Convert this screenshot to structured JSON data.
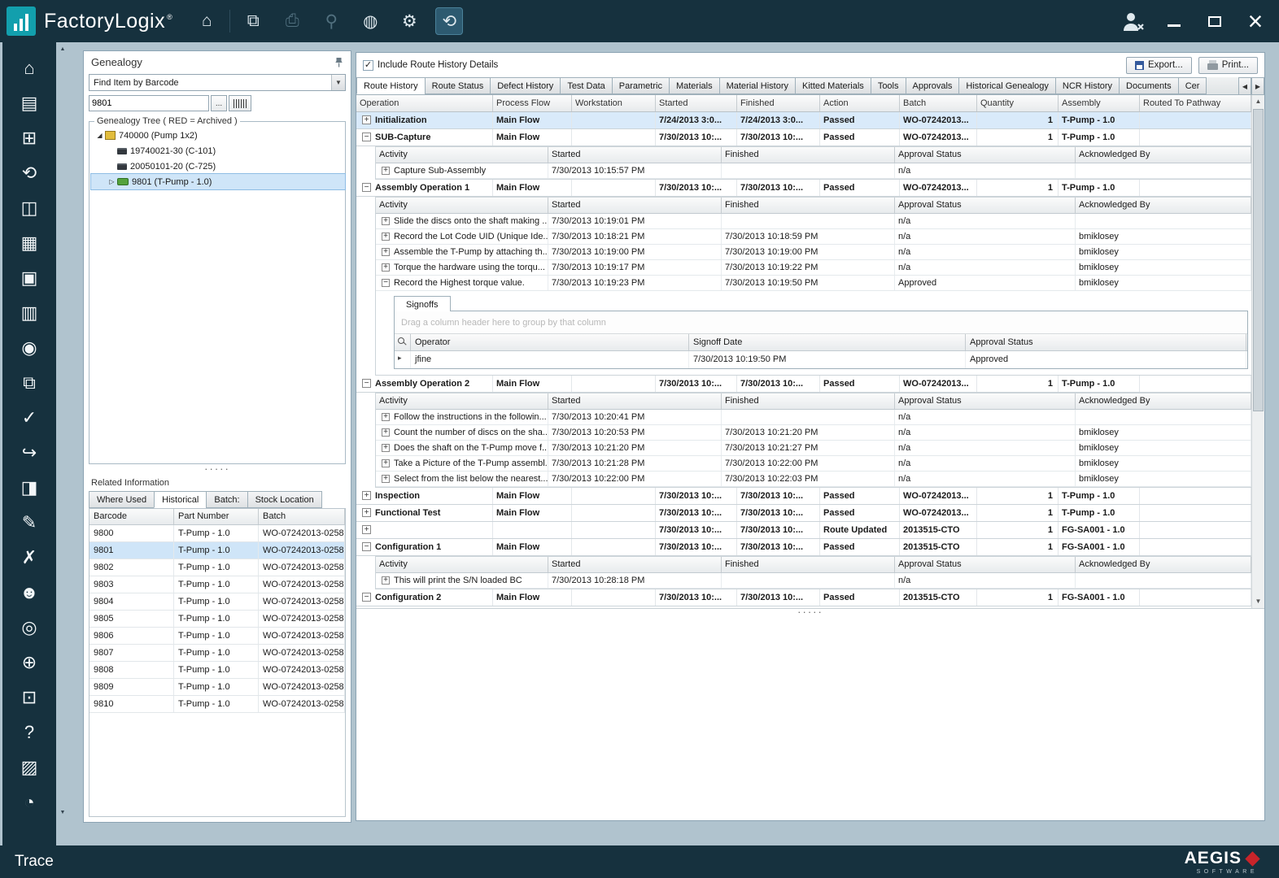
{
  "topbar": {
    "app_name": "FactoryLogix",
    "registered_mark": "®",
    "icons": [
      {
        "name": "home-icon",
        "disabled": false,
        "active": false
      },
      {
        "name": "documents-icon",
        "disabled": false,
        "active": false
      },
      {
        "name": "printer-icon",
        "disabled": true,
        "active": false
      },
      {
        "name": "location-pin-icon",
        "disabled": true,
        "active": false
      },
      {
        "name": "globe-icon",
        "disabled": false,
        "active": false
      },
      {
        "name": "settings-gear-icon",
        "disabled": false,
        "active": false
      },
      {
        "name": "trace-module-icon",
        "disabled": false,
        "active": true
      }
    ]
  },
  "sidebar": {
    "icons": [
      "home-icon",
      "materials-icon",
      "process-flow-icon",
      "trace-icon",
      "monitor-icon",
      "data-query-icon",
      "warehouse-icon",
      "documentation-icon",
      "inspection-icon",
      "documents-copy-icon",
      "tasks-check-icon",
      "export-icon",
      "badge-icon",
      "notes-icon",
      "measure-cancel-icon",
      "operator-time-icon",
      "operator-search-icon",
      "package-add-icon",
      "package-doc-icon",
      "operator-help-icon",
      "clipboard-icon",
      "analytics-icon"
    ]
  },
  "genealogy": {
    "title": "Genealogy",
    "search_combo": "Find Item by Barcode",
    "barcode_input": "9801",
    "ellipsis_button": "...",
    "tree_group_label": "Genealogy Tree ( RED = Archived )",
    "splitter_dots": "·····",
    "tree": [
      {
        "label": "740000 (Pump 1x2)",
        "level": 0,
        "expanded": true,
        "icon": "assembly-icon",
        "selected": false
      },
      {
        "label": "19740021-30 (C-101)",
        "level": 1,
        "expanded": false,
        "icon": "component-icon",
        "selected": false
      },
      {
        "label": "20050101-20 (C-725)",
        "level": 1,
        "expanded": false,
        "icon": "component-icon",
        "selected": false
      },
      {
        "label": "9801 (T-Pump - 1.0)",
        "level": 1,
        "expanded": false,
        "expandable": true,
        "icon": "board-icon",
        "selected": true
      }
    ],
    "related": {
      "title": "Related Information",
      "tabs": [
        "Where Used",
        "Historical",
        "Batch:",
        "Stock Location"
      ],
      "active_tab": "Historical",
      "columns": [
        "Barcode",
        "Part Number",
        "Batch"
      ],
      "selected_row": "9801",
      "rows": [
        [
          "9800",
          "T-Pump - 1.0",
          "WO-07242013-0258"
        ],
        [
          "9801",
          "T-Pump - 1.0",
          "WO-07242013-0258"
        ],
        [
          "9802",
          "T-Pump - 1.0",
          "WO-07242013-0258"
        ],
        [
          "9803",
          "T-Pump - 1.0",
          "WO-07242013-0258"
        ],
        [
          "9804",
          "T-Pump - 1.0",
          "WO-07242013-0258"
        ],
        [
          "9805",
          "T-Pump - 1.0",
          "WO-07242013-0258"
        ],
        [
          "9806",
          "T-Pump - 1.0",
          "WO-07242013-0258"
        ],
        [
          "9807",
          "T-Pump - 1.0",
          "WO-07242013-0258"
        ],
        [
          "9808",
          "T-Pump - 1.0",
          "WO-07242013-0258"
        ],
        [
          "9809",
          "T-Pump - 1.0",
          "WO-07242013-0258"
        ],
        [
          "9810",
          "T-Pump - 1.0",
          "WO-07242013-0258"
        ]
      ]
    }
  },
  "main": {
    "include_details_checkbox": {
      "label": "Include Route History Details",
      "checked": true
    },
    "export_button": "Export...",
    "print_button": "Print...",
    "tabs": [
      "Route History",
      "Route Status",
      "Defect History",
      "Test Data",
      "Parametric",
      "Materials",
      "Material History",
      "Kitted Materials",
      "Tools",
      "Approvals",
      "Historical Genealogy",
      "NCR History",
      "Documents",
      "Cer"
    ],
    "active_tab": "Route History",
    "splitter_dots": "·····",
    "grid": {
      "columns": [
        "Operation",
        "Process Flow",
        "Workstation",
        "Started",
        "Finished",
        "Action",
        "Batch",
        "Quantity",
        "Assembly",
        "Routed To Pathway"
      ],
      "detail_columns": [
        "Activity",
        "Started",
        "Finished",
        "Approval Status",
        "Acknowledged By"
      ],
      "signoffs": {
        "tab": "Signoffs",
        "groupby_hint": "Drag a column header here to group by that column",
        "columns": [
          "Operator",
          "Signoff Date",
          "Approval Status"
        ],
        "rows": [
          [
            "jfine",
            "7/30/2013 10:19:50 PM",
            "Approved"
          ]
        ]
      },
      "rows": [
        {
          "expand": "+",
          "op": "Initialization",
          "flow": "Main Flow",
          "workstation": "",
          "started": "7/24/2013 3:0...",
          "finished": "7/24/2013 3:0...",
          "action": "Passed",
          "batch": "WO-07242013...",
          "qty": "1",
          "assembly": "T-Pump - 1.0",
          "routed": "",
          "selected": true
        },
        {
          "expand": "-",
          "op": "SUB-Capture",
          "flow": "Main Flow",
          "workstation": "",
          "started": "7/30/2013 10:...",
          "finished": "7/30/2013 10:...",
          "action": "Passed",
          "batch": "WO-07242013...",
          "qty": "1",
          "assembly": "T-Pump - 1.0",
          "routed": "",
          "selected": false,
          "details": [
            {
              "expand": "+",
              "activity": "Capture Sub-Assembly",
              "started": "7/30/2013 10:15:57 PM",
              "finished": "",
              "approval": "n/a",
              "ack": ""
            }
          ]
        },
        {
          "expand": "-",
          "op": "Assembly Operation 1",
          "flow": "Main Flow",
          "workstation": "",
          "started": "7/30/2013 10:...",
          "finished": "7/30/2013 10:...",
          "action": "Passed",
          "batch": "WO-07242013...",
          "qty": "1",
          "assembly": "T-Pump - 1.0",
          "routed": "",
          "selected": false,
          "details": [
            {
              "expand": "+",
              "activity": "Slide the discs onto the shaft making ...",
              "started": "7/30/2013 10:19:01 PM",
              "finished": "",
              "approval": "n/a",
              "ack": ""
            },
            {
              "expand": "+",
              "activity": "Record the Lot Code UID (Unique Ide...",
              "started": "7/30/2013 10:18:21 PM",
              "finished": "7/30/2013 10:18:59 PM",
              "approval": "n/a",
              "ack": "bmiklosey"
            },
            {
              "expand": "+",
              "activity": "Assemble the T-Pump by attaching th...",
              "started": "7/30/2013 10:19:00 PM",
              "finished": "7/30/2013 10:19:00 PM",
              "approval": "n/a",
              "ack": "bmiklosey"
            },
            {
              "expand": "+",
              "activity": "Torque the hardware using the torqu...",
              "started": "7/30/2013 10:19:17 PM",
              "finished": "7/30/2013 10:19:22 PM",
              "approval": "n/a",
              "ack": "bmiklosey"
            },
            {
              "expand": "-",
              "activity": "Record the Highest torque value.",
              "started": "7/30/2013 10:19:23 PM",
              "finished": "7/30/2013 10:19:50 PM",
              "approval": "Approved",
              "ack": "bmiklosey",
              "signoffs": true
            }
          ]
        },
        {
          "expand": "-",
          "op": "Assembly Operation 2",
          "flow": "Main Flow",
          "workstation": "",
          "started": "7/30/2013 10:...",
          "finished": "7/30/2013 10:...",
          "action": "Passed",
          "batch": "WO-07242013...",
          "qty": "1",
          "assembly": "T-Pump - 1.0",
          "routed": "",
          "selected": false,
          "details": [
            {
              "expand": "+",
              "activity": "Follow the instructions in the followin...",
              "started": "7/30/2013 10:20:41 PM",
              "finished": "",
              "approval": "n/a",
              "ack": ""
            },
            {
              "expand": "+",
              "activity": "Count the number of discs on the sha...",
              "started": "7/30/2013 10:20:53 PM",
              "finished": "7/30/2013 10:21:20 PM",
              "approval": "n/a",
              "ack": "bmiklosey"
            },
            {
              "expand": "+",
              "activity": "Does the shaft on the T-Pump move f...",
              "started": "7/30/2013 10:21:20 PM",
              "finished": "7/30/2013 10:21:27 PM",
              "approval": "n/a",
              "ack": "bmiklosey"
            },
            {
              "expand": "+",
              "activity": "Take a Picture of the T-Pump assembl...",
              "started": "7/30/2013 10:21:28 PM",
              "finished": "7/30/2013 10:22:00 PM",
              "approval": "n/a",
              "ack": "bmiklosey"
            },
            {
              "expand": "+",
              "activity": "Select from the list below the nearest...",
              "started": "7/30/2013 10:22:00 PM",
              "finished": "7/30/2013 10:22:03 PM",
              "approval": "n/a",
              "ack": "bmiklosey"
            }
          ]
        },
        {
          "expand": "+",
          "op": "Inspection",
          "flow": "Main Flow",
          "workstation": "",
          "started": "7/30/2013 10:...",
          "finished": "7/30/2013 10:...",
          "action": "Passed",
          "batch": "WO-07242013...",
          "qty": "1",
          "assembly": "T-Pump - 1.0",
          "routed": "",
          "selected": false
        },
        {
          "expand": "+",
          "op": "Functional Test",
          "flow": "Main Flow",
          "workstation": "",
          "started": "7/30/2013 10:...",
          "finished": "7/30/2013 10:...",
          "action": "Passed",
          "batch": "WO-07242013...",
          "qty": "1",
          "assembly": "T-Pump - 1.0",
          "routed": "",
          "selected": false
        },
        {
          "expand": "+",
          "op": "",
          "flow": "",
          "workstation": "",
          "started": "7/30/2013 10:...",
          "finished": "7/30/2013 10:...",
          "action": "Route Updated",
          "batch": "2013515-CTO",
          "qty": "1",
          "assembly": "FG-SA001 - 1.0",
          "routed": "",
          "selected": false
        },
        {
          "expand": "-",
          "op": "Configuration 1",
          "flow": "Main Flow",
          "workstation": "",
          "started": "7/30/2013 10:...",
          "finished": "7/30/2013 10:...",
          "action": "Passed",
          "batch": "2013515-CTO",
          "qty": "1",
          "assembly": "FG-SA001 - 1.0",
          "routed": "",
          "selected": false,
          "details": [
            {
              "expand": "+",
              "activity": "This will print the S/N loaded BC",
              "started": "7/30/2013 10:28:18 PM",
              "finished": "",
              "approval": "n/a",
              "ack": ""
            }
          ]
        },
        {
          "expand": "-",
          "op": "Configuration 2",
          "flow": "Main Flow",
          "workstation": "",
          "started": "7/30/2013 10:...",
          "finished": "7/30/2013 10:...",
          "action": "Passed",
          "batch": "2013515-CTO",
          "qty": "1",
          "assembly": "FG-SA001 - 1.0",
          "routed": "",
          "selected": false
        }
      ]
    }
  },
  "bottom": {
    "module": "Trace",
    "brand": "AEGIS",
    "brand_sub": "SOFTWARE"
  }
}
